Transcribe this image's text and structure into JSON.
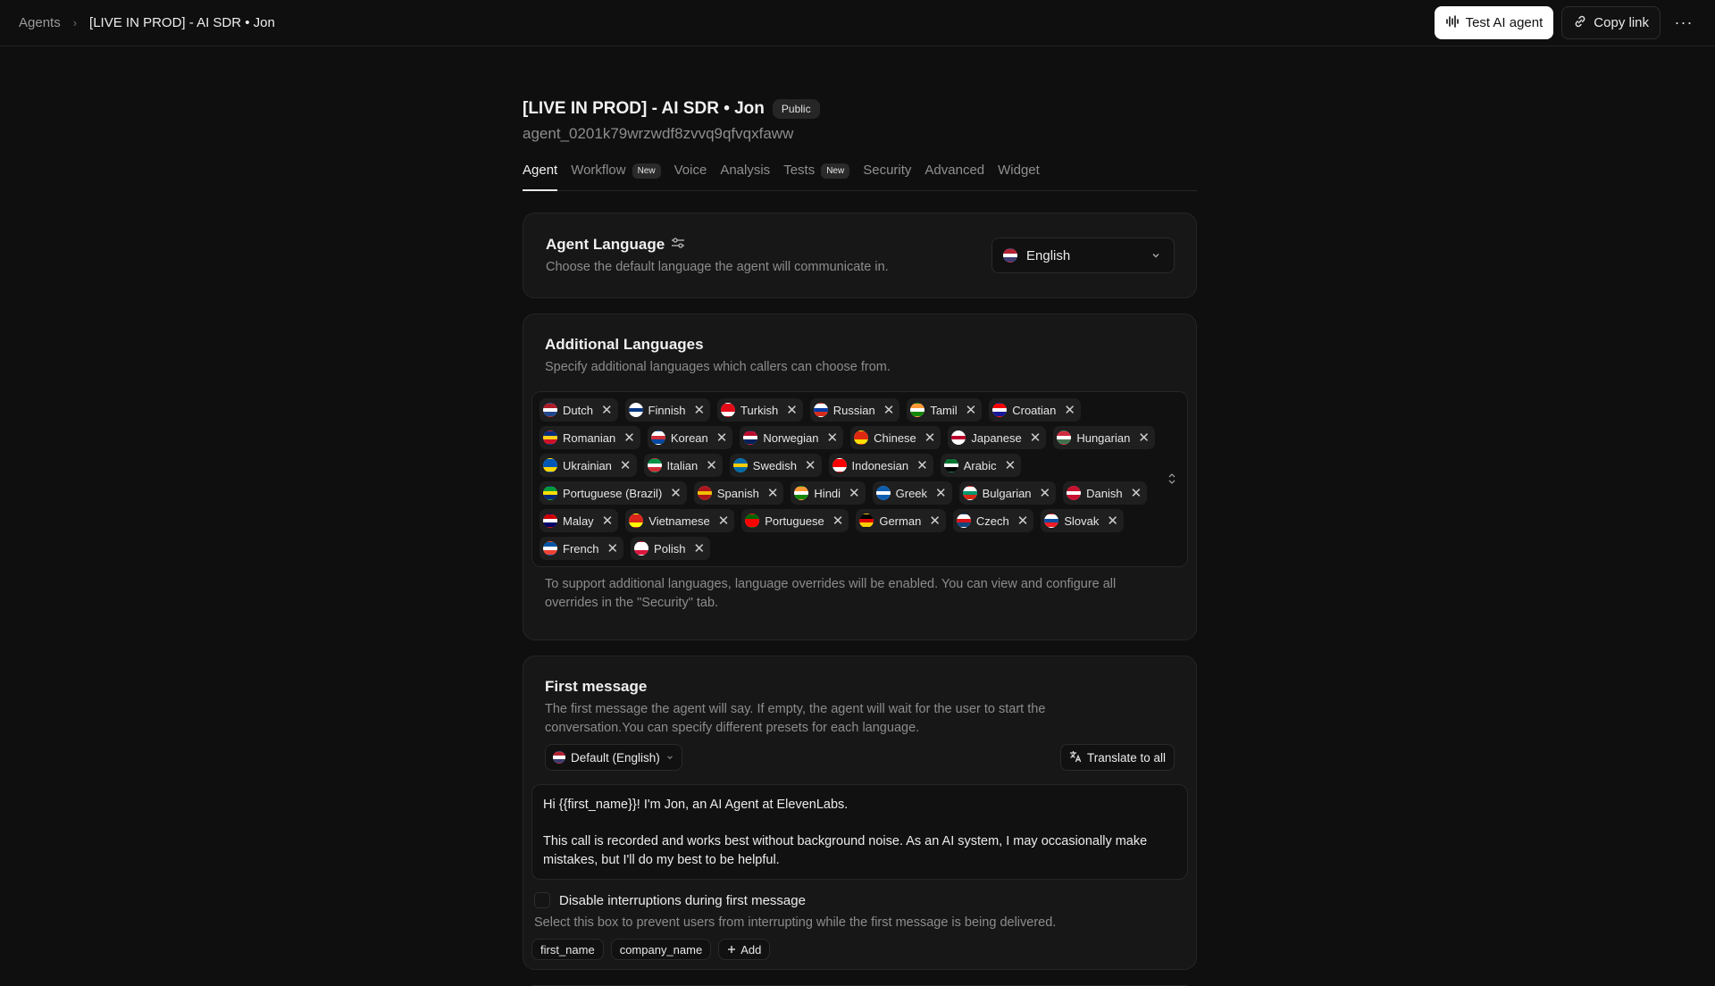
{
  "breadcrumb": {
    "root": "Agents",
    "separator": "›",
    "current": "[LIVE IN PROD] - AI SDR • Jon"
  },
  "top_actions": {
    "test_label": "Test AI agent",
    "copy_label": "Copy link",
    "more": "···"
  },
  "header": {
    "title": "[LIVE IN PROD] - AI SDR • Jon",
    "visibility_badge": "Public",
    "agent_id": "agent_0201k79wrzwdf8zvvq9qfvqxfaww"
  },
  "tabs": [
    {
      "label": "Agent",
      "active": true,
      "badge": ""
    },
    {
      "label": "Workflow",
      "active": false,
      "badge": "New"
    },
    {
      "label": "Voice",
      "active": false,
      "badge": ""
    },
    {
      "label": "Analysis",
      "active": false,
      "badge": ""
    },
    {
      "label": "Tests",
      "active": false,
      "badge": "New"
    },
    {
      "label": "Security",
      "active": false,
      "badge": ""
    },
    {
      "label": "Advanced",
      "active": false,
      "badge": ""
    },
    {
      "label": "Widget",
      "active": false,
      "badge": ""
    }
  ],
  "agent_language": {
    "title": "Agent Language",
    "description": "Choose the default language the agent will communicate in.",
    "selected": "English",
    "flag": "us"
  },
  "additional_languages": {
    "title": "Additional Languages",
    "description": "Specify additional languages which callers can choose from.",
    "languages": [
      {
        "name": "Dutch",
        "flag": "nl"
      },
      {
        "name": "Finnish",
        "flag": "fi"
      },
      {
        "name": "Turkish",
        "flag": "tr"
      },
      {
        "name": "Russian",
        "flag": "ru"
      },
      {
        "name": "Tamil",
        "flag": "in"
      },
      {
        "name": "Croatian",
        "flag": "hr"
      },
      {
        "name": "Romanian",
        "flag": "ro"
      },
      {
        "name": "Korean",
        "flag": "kr"
      },
      {
        "name": "Norwegian",
        "flag": "no"
      },
      {
        "name": "Chinese",
        "flag": "cn"
      },
      {
        "name": "Japanese",
        "flag": "jp"
      },
      {
        "name": "Hungarian",
        "flag": "hu"
      },
      {
        "name": "Ukrainian",
        "flag": "ua"
      },
      {
        "name": "Italian",
        "flag": "it"
      },
      {
        "name": "Swedish",
        "flag": "se"
      },
      {
        "name": "Indonesian",
        "flag": "id"
      },
      {
        "name": "Arabic",
        "flag": "ae"
      },
      {
        "name": "Portuguese (Brazil)",
        "flag": "br"
      },
      {
        "name": "Spanish",
        "flag": "es"
      },
      {
        "name": "Hindi",
        "flag": "in"
      },
      {
        "name": "Greek",
        "flag": "gr"
      },
      {
        "name": "Bulgarian",
        "flag": "bg"
      },
      {
        "name": "Danish",
        "flag": "dk"
      },
      {
        "name": "Malay",
        "flag": "my"
      },
      {
        "name": "Vietnamese",
        "flag": "vn"
      },
      {
        "name": "Portuguese",
        "flag": "pt"
      },
      {
        "name": "German",
        "flag": "de"
      },
      {
        "name": "Czech",
        "flag": "cz"
      },
      {
        "name": "Slovak",
        "flag": "sk"
      },
      {
        "name": "French",
        "flag": "fr"
      },
      {
        "name": "Polish",
        "flag": "pl"
      }
    ],
    "note": "To support additional languages, language overrides will be enabled. You can view and configure all overrides in the \"Security\" tab."
  },
  "first_message": {
    "title": "First message",
    "description": "The first message the agent will say. If empty, the agent will wait for the user to start the conversation.You can specify different presets for each language.",
    "preset_label": "Default (English)",
    "translate_label": "Translate to all",
    "message_line1": "Hi {{first_name}}! I'm Jon, an AI Agent at ElevenLabs.",
    "message_line2": "This call is recorded and works best without background noise. As an AI system, I may occasionally make mistakes, but I'll do my best to be helpful.",
    "disable_interruptions_label": "Disable interruptions during first message",
    "disable_interruptions_checked": false,
    "disable_interruptions_help": "Select this box to prevent users from interrupting while the first message is being delivered.",
    "variables": [
      "first_name",
      "company_name"
    ],
    "add_variable_label": "Add"
  },
  "flag_colors": {
    "us": [
      "#b22234",
      "#ffffff",
      "#3c3b6e"
    ],
    "nl": [
      "#ae1c28",
      "#ffffff",
      "#21468b"
    ],
    "fi": [
      "#ffffff",
      "#003580",
      "#ffffff"
    ],
    "tr": [
      "#e30a17",
      "#e30a17",
      "#ffffff"
    ],
    "ru": [
      "#ffffff",
      "#0039a6",
      "#d52b1e"
    ],
    "in": [
      "#ff9933",
      "#ffffff",
      "#138808"
    ],
    "hr": [
      "#ff0000",
      "#ffffff",
      "#171796"
    ],
    "ro": [
      "#002b7f",
      "#fcd116",
      "#ce1126"
    ],
    "kr": [
      "#ffffff",
      "#cd2e3a",
      "#0047a0"
    ],
    "no": [
      "#ba0c2f",
      "#ffffff",
      "#00205b"
    ],
    "cn": [
      "#de2910",
      "#de2910",
      "#ffde00"
    ],
    "jp": [
      "#ffffff",
      "#bc002d",
      "#ffffff"
    ],
    "hu": [
      "#cd2a3e",
      "#ffffff",
      "#436f4d"
    ],
    "ua": [
      "#0057b7",
      "#0057b7",
      "#ffd700"
    ],
    "it": [
      "#009246",
      "#ffffff",
      "#ce2b37"
    ],
    "se": [
      "#006aa7",
      "#fecc00",
      "#006aa7"
    ],
    "id": [
      "#ff0000",
      "#ff0000",
      "#ffffff"
    ],
    "ae": [
      "#00732f",
      "#ffffff",
      "#000000"
    ],
    "br": [
      "#009c3b",
      "#ffdf00",
      "#002776"
    ],
    "es": [
      "#aa151b",
      "#f1bf00",
      "#aa151b"
    ],
    "gr": [
      "#0d5eaf",
      "#ffffff",
      "#0d5eaf"
    ],
    "bg": [
      "#ffffff",
      "#00966e",
      "#d62612"
    ],
    "dk": [
      "#c8102e",
      "#ffffff",
      "#c8102e"
    ],
    "my": [
      "#cc0001",
      "#ffffff",
      "#010066"
    ],
    "vn": [
      "#da251d",
      "#da251d",
      "#ffff00"
    ],
    "pt": [
      "#006600",
      "#ff0000",
      "#ff0000"
    ],
    "de": [
      "#000000",
      "#dd0000",
      "#ffce00"
    ],
    "cz": [
      "#ffffff",
      "#d7141a",
      "#11457e"
    ],
    "sk": [
      "#ffffff",
      "#0b4ea2",
      "#ee1c25"
    ],
    "fr": [
      "#0055a4",
      "#ffffff",
      "#ef4135"
    ],
    "pl": [
      "#ffffff",
      "#ffffff",
      "#dc143c"
    ]
  }
}
